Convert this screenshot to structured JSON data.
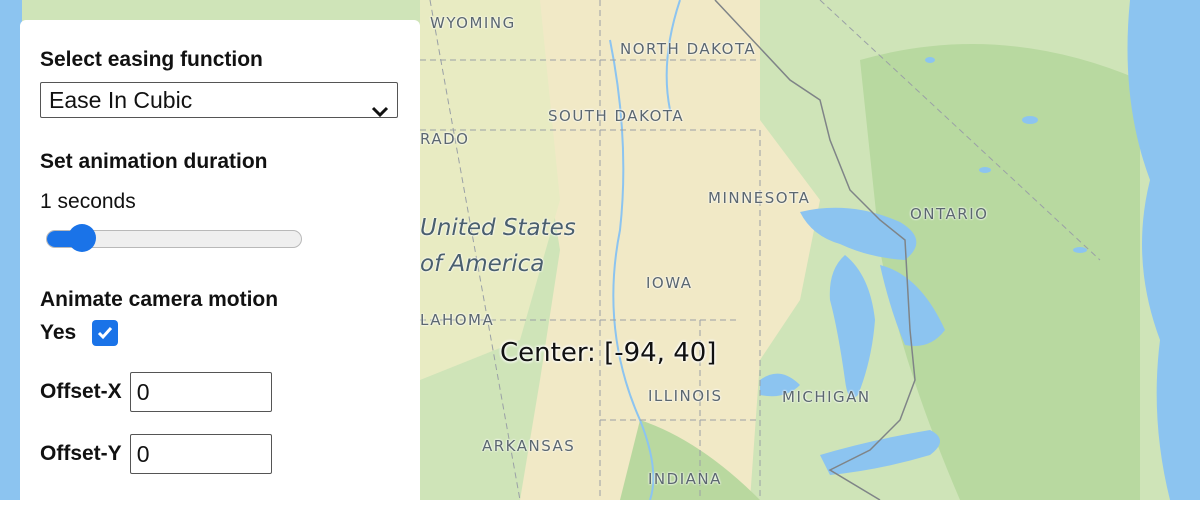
{
  "panel": {
    "easing_heading": "Select easing function",
    "easing_selected": "Ease In Cubic",
    "duration_heading": "Set animation duration",
    "duration_value": "1 seconds",
    "duration_slider_fraction": 0.14,
    "camera_heading": "Animate camera motion",
    "camera_label": "Yes",
    "camera_checked": true,
    "offset_x_label": "Offset-X",
    "offset_x_value": "0",
    "offset_y_label": "Offset-Y",
    "offset_y_value": "0"
  },
  "map": {
    "center_readout": "Center: [-94, 40]",
    "labels": {
      "wyoming": "WYOMING",
      "north_dakota": "NORTH DAKOTA",
      "south_dakota": "SOUTH DAKOTA",
      "colorado": "RADO",
      "minnesota": "MINNESOTA",
      "ontario": "ONTARIO",
      "iowa": "IOWA",
      "oklahoma": "LAHOMA",
      "illinois": "ILLINOIS",
      "michigan": "MICHIGAN",
      "arkansas": "ARKANSAS",
      "indiana": "INDIANA",
      "country_line1": "United States",
      "country_line2": "of America"
    },
    "colors": {
      "water": "#8cc4f0",
      "land_green": "#c9e2b3",
      "land_tan": "#f1e9c6",
      "accent": "#1a73e8"
    }
  }
}
